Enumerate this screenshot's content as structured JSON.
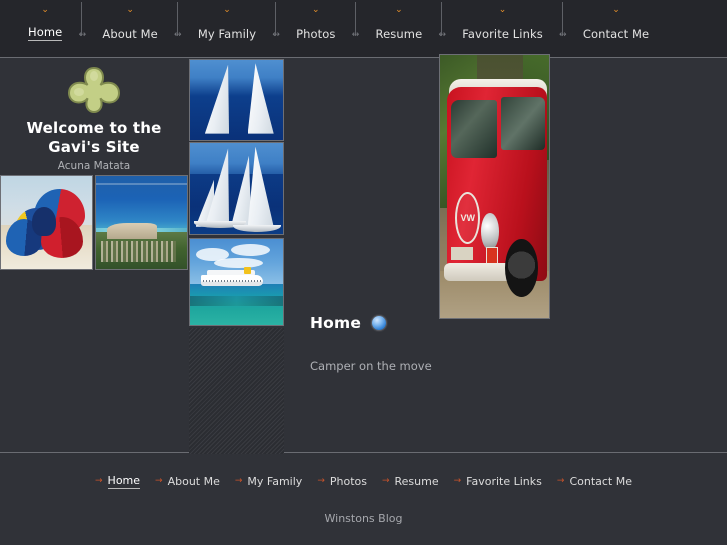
{
  "site": {
    "title": "Welcome to the Gavi's Site",
    "title_line1": "Welcome to the",
    "title_line2": "Gavi's Site",
    "tagline": "Acuna Matata",
    "logo_icon": "trefoil-clover-icon"
  },
  "theme": {
    "page_background": "#303238",
    "nav_background": "#25262b",
    "rule_color": "#6a6c72",
    "accent_orange": "#e8912a",
    "footer_arrow": "#c8532a",
    "logo_green": "#c3cf86",
    "heading_white": "#ffffff",
    "body_text": "#aeb0b5",
    "bullet_blue": "#2f7fd4"
  },
  "topnav": {
    "chevron_icon": "chevron-down-icon",
    "separator_icon": "horizontal-resize-arrow-icon",
    "items": [
      {
        "label": "Home",
        "active": true
      },
      {
        "label": "About Me",
        "active": false
      },
      {
        "label": "My Family",
        "active": false
      },
      {
        "label": "Photos",
        "active": false
      },
      {
        "label": "Resume",
        "active": false
      },
      {
        "label": "Favorite Links",
        "active": false
      },
      {
        "label": "Contact Me",
        "active": false
      }
    ]
  },
  "sidebar": {
    "thumbnails": [
      {
        "name": "beach-umbrellas-photo",
        "alt": "Colorful beach umbrellas on sand"
      },
      {
        "name": "coastal-aerial-photo",
        "alt": "Aerial view of coastline with turquoise sea"
      }
    ]
  },
  "image_column": {
    "tiles": [
      {
        "name": "sailboat-photo-top",
        "alt": "Sailboat masts against blue sky"
      },
      {
        "name": "sailboat-photo-bottom",
        "alt": "White sailing yacht on open sea"
      },
      {
        "name": "cruise-ship-photo",
        "alt": "Cruise ship on turquoise water"
      }
    ],
    "filler": "diagonal-stripe-texture"
  },
  "main": {
    "hero_image": {
      "name": "red-camper-van-photo",
      "alt": "Red Volkswagen camper van"
    },
    "heading": "Home",
    "heading_bullet_icon": "blue-bullet-icon",
    "body_text": "Camper on the move"
  },
  "footer": {
    "arrow_icon": "arrow-right-small-icon",
    "items": [
      {
        "label": "Home",
        "active": true
      },
      {
        "label": "About Me",
        "active": false
      },
      {
        "label": "My Family",
        "active": false
      },
      {
        "label": "Photos",
        "active": false
      },
      {
        "label": "Resume",
        "active": false
      },
      {
        "label": "Favorite Links",
        "active": false
      },
      {
        "label": "Contact Me",
        "active": false
      }
    ],
    "note": "Winstons Blog"
  }
}
